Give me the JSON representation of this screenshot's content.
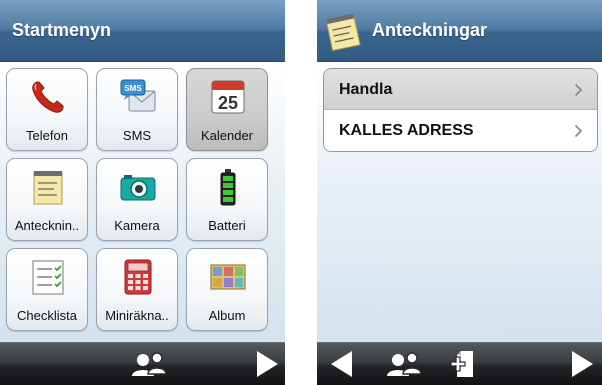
{
  "left_screen": {
    "title": "Startmenyn",
    "tiles": [
      {
        "label": "Telefon",
        "icon": "phone-icon"
      },
      {
        "label": "SMS",
        "icon": "sms-icon"
      },
      {
        "label": "Kalender",
        "icon": "calendar-icon",
        "icon_text": "25",
        "selected": true
      },
      {
        "label": "Antecknin..",
        "icon": "notepad-icon"
      },
      {
        "label": "Kamera",
        "icon": "camera-icon"
      },
      {
        "label": "Batteri",
        "icon": "battery-icon"
      },
      {
        "label": "Checklista",
        "icon": "checklist-icon"
      },
      {
        "label": "Miniräkna..",
        "icon": "calculator-icon"
      },
      {
        "label": "Album",
        "icon": "album-icon"
      }
    ],
    "bottom_bar": [
      "contacts-icon",
      "forward-arrow-icon"
    ]
  },
  "right_screen": {
    "title": "Anteckningar",
    "title_icon": "notepad-icon",
    "items": [
      {
        "label": "Handla",
        "selected": true
      },
      {
        "label": "KALLES ADRESS",
        "selected": false
      }
    ],
    "bottom_bar": [
      "back-arrow-icon",
      "contacts-icon",
      "add-note-icon",
      "forward-arrow-icon"
    ]
  },
  "colors": {
    "title_bar": "#4f7aa3",
    "content_bg": "#dae6f0",
    "bottom_bar": "#232528",
    "selected_tile": "#cbcbcb"
  }
}
